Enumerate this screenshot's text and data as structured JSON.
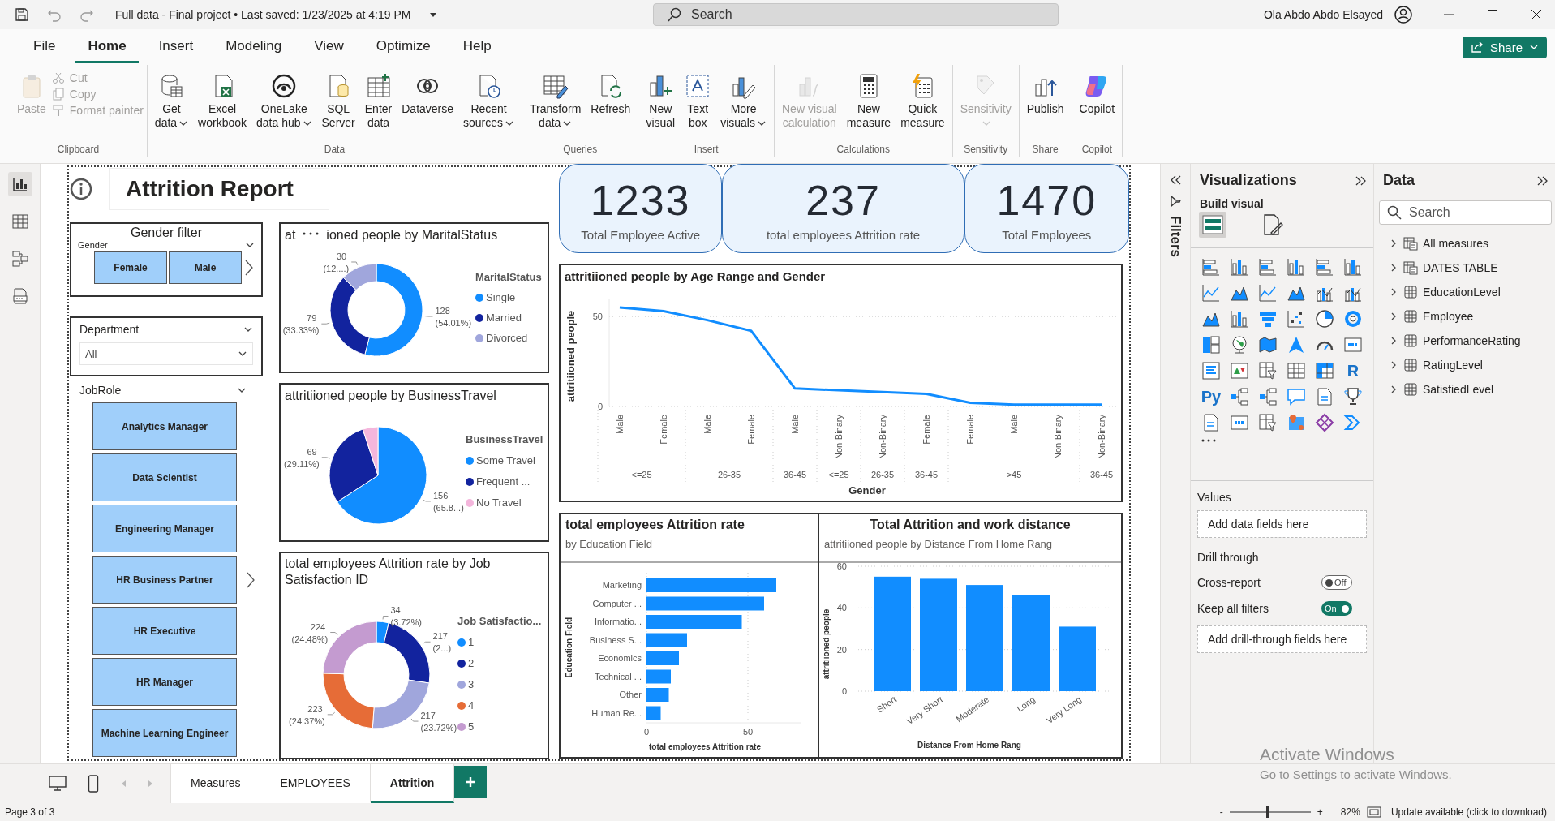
{
  "title_bar": {
    "document_title": "Full data - Final project • Last saved: 1/23/2025 at 4:19 PM",
    "search_placeholder": "Search",
    "user_name": "Ola Abdo Abdo Elsayed"
  },
  "menu": {
    "tabs": [
      {
        "label": "File",
        "selected": false
      },
      {
        "label": "Home",
        "selected": true
      },
      {
        "label": "Insert",
        "selected": false
      },
      {
        "label": "Modeling",
        "selected": false
      },
      {
        "label": "View",
        "selected": false
      },
      {
        "label": "Optimize",
        "selected": false
      },
      {
        "label": "Help",
        "selected": false
      }
    ],
    "share_button": "Share"
  },
  "ribbon": {
    "groups": [
      {
        "name": "Clipboard",
        "items": [
          {
            "lines": [
              "Paste"
            ],
            "kind": "large",
            "disabled": true,
            "caret": false
          },
          {
            "lines": [
              "Cut"
            ],
            "kind": "small",
            "disabled": true,
            "caret": false
          },
          {
            "lines": [
              "Copy"
            ],
            "kind": "small",
            "disabled": true,
            "caret": false
          },
          {
            "lines": [
              "Format painter"
            ],
            "kind": "small",
            "disabled": true,
            "caret": false
          }
        ]
      },
      {
        "name": "Data",
        "items": [
          {
            "lines": [
              "Get",
              "data"
            ],
            "kind": "large",
            "disabled": false,
            "caret": true
          },
          {
            "lines": [
              "Excel",
              "workbook"
            ],
            "kind": "large",
            "disabled": false,
            "caret": false
          },
          {
            "lines": [
              "OneLake",
              "data hub"
            ],
            "kind": "large",
            "disabled": false,
            "caret": true
          },
          {
            "lines": [
              "SQL",
              "Server"
            ],
            "kind": "large",
            "disabled": false,
            "caret": false
          },
          {
            "lines": [
              "Enter",
              "data"
            ],
            "kind": "large",
            "disabled": false,
            "caret": false
          },
          {
            "lines": [
              "Dataverse"
            ],
            "kind": "large",
            "disabled": false,
            "caret": false
          },
          {
            "lines": [
              "Recent",
              "sources"
            ],
            "kind": "large",
            "disabled": false,
            "caret": true
          }
        ]
      },
      {
        "name": "Queries",
        "items": [
          {
            "lines": [
              "Transform",
              "data"
            ],
            "kind": "large",
            "disabled": false,
            "caret": true
          },
          {
            "lines": [
              "Refresh"
            ],
            "kind": "large",
            "disabled": false,
            "caret": false
          }
        ]
      },
      {
        "name": "Insert",
        "items": [
          {
            "lines": [
              "New",
              "visual"
            ],
            "kind": "large",
            "disabled": false,
            "caret": false
          },
          {
            "lines": [
              "Text",
              "box"
            ],
            "kind": "large",
            "disabled": false,
            "caret": false
          },
          {
            "lines": [
              "More",
              "visuals"
            ],
            "kind": "large",
            "disabled": false,
            "caret": true
          }
        ]
      },
      {
        "name": "Calculations",
        "items": [
          {
            "lines": [
              "New visual",
              "calculation"
            ],
            "kind": "large",
            "disabled": true,
            "caret": false
          },
          {
            "lines": [
              "New",
              "measure"
            ],
            "kind": "large",
            "disabled": false,
            "caret": false
          },
          {
            "lines": [
              "Quick",
              "measure"
            ],
            "kind": "large",
            "disabled": false,
            "caret": false
          }
        ]
      },
      {
        "name": "Sensitivity",
        "items": [
          {
            "lines": [
              "Sensitivity"
            ],
            "kind": "large",
            "disabled": true,
            "caret": true
          }
        ]
      },
      {
        "name": "Share",
        "items": [
          {
            "lines": [
              "Publish"
            ],
            "kind": "large",
            "disabled": false,
            "caret": false
          }
        ]
      },
      {
        "name": "Copilot",
        "items": [
          {
            "lines": [
              "Copilot"
            ],
            "kind": "large",
            "disabled": false,
            "caret": false
          }
        ]
      }
    ]
  },
  "nav": [
    {
      "selected": true
    },
    {
      "selected": false
    },
    {
      "selected": false
    },
    {
      "selected": false
    }
  ],
  "report": {
    "title": "Attrition Report",
    "kpis": [
      {
        "value": "1233",
        "label": "Total Employee Active"
      },
      {
        "value": "237",
        "label": "total employees Attrition rate"
      },
      {
        "value": "1470",
        "label": "Total Employees"
      }
    ],
    "gender_slicer": {
      "title": "Gender filter",
      "header": "Gender",
      "tiles": [
        "Female",
        "Male"
      ]
    },
    "department_slicer": {
      "header": "Department",
      "value": "All"
    },
    "jobrole_slicer": {
      "header": "JobRole",
      "tiles": [
        "Analytics Manager",
        "Data Scientist",
        "Engineering Manager",
        "HR Business Partner",
        "HR Executive",
        "HR Manager",
        "Machine Learning Engineer"
      ]
    },
    "marital": {
      "title_parts": [
        "at",
        "ioned people by MaritalStatus"
      ],
      "chart_data": {
        "type": "donut",
        "categories": [
          "Single",
          "Married",
          "Divorced"
        ],
        "values": [
          128,
          79,
          30
        ],
        "colors": [
          "#118dff",
          "#12239e",
          "#a0a6dc"
        ],
        "value_labels": [
          "128 (54.01%)",
          "79 (33.33%)",
          "30 (12....)"
        ],
        "legend": {
          "title": "MaritalStatus"
        }
      }
    },
    "travel": {
      "title": "attritiioned people by BusinessTravel",
      "chart_data": {
        "type": "pie",
        "categories": [
          "Some Travel",
          "Frequent ...",
          "No Travel"
        ],
        "values": [
          156,
          69,
          12
        ],
        "colors": [
          "#118dff",
          "#12239e",
          "#f4b6dc"
        ],
        "value_labels": [
          "156 (65.8...)",
          "69 (29.11%)",
          null
        ],
        "legend": {
          "title": "BusinessTravel"
        }
      }
    },
    "jobsat": {
      "title": "total employees Attrition rate by Job Satisfaction ID",
      "chart_data": {
        "type": "donut",
        "categories": [
          "1",
          "2",
          "3",
          "4",
          "5"
        ],
        "values": [
          34,
          217,
          217,
          223,
          224
        ],
        "colors": [
          "#118dff",
          "#12239e",
          "#a0a6dc",
          "#e66c37",
          "#c49bd0"
        ],
        "value_labels": [
          "34 (3.72%)",
          "217 (2...)",
          "217 (23.72%)",
          "223 (24.37%)",
          "224 (24.48%)"
        ],
        "legend": {
          "title": "Job Satisfactio..."
        }
      }
    },
    "age_line": {
      "title": "attritiioned people by Age Range and Gender",
      "chart_data": {
        "type": "line",
        "categories": [
          "Male",
          "Female",
          "Male",
          "Female",
          "Male",
          "Non-Binary",
          "Non-Binary",
          "Female",
          "Female",
          "Male",
          "Non-Binary",
          "Non-Binary"
        ],
        "annotations": [
          "<=25",
          "26-35",
          "36-45",
          "<=25",
          "26-35",
          "36-45",
          ">45",
          "36-45"
        ],
        "series": [
          {
            "color": "#118dff",
            "values": [
              55,
              53,
              48,
              42,
              10,
              9,
              8,
              7,
              2,
              1,
              1,
              1
            ]
          }
        ],
        "xlabel": "Gender",
        "ylabel": "attritiioned people",
        "ylim": [
          0,
          60
        ],
        "yticks": [
          0,
          50
        ]
      }
    },
    "education": {
      "title": "total employees Attrition rate",
      "subtitle": "by Education Field",
      "chart_data": {
        "type": "bar",
        "orientation": "horizontal",
        "categories": [
          "Marketing",
          "Computer ...",
          "Informatio...",
          "Business S...",
          "Economics",
          "Technical ...",
          "Other",
          "Human Re..."
        ],
        "series": [
          {
            "color": "#118dff",
            "values": [
              64,
              58,
              47,
              20,
              16,
              12,
              11,
              7
            ]
          }
        ],
        "xlabel": "total employees Attrition rate",
        "ylabel": "Education Field",
        "xlim": [
          0,
          76
        ],
        "xticks": [
          0,
          50
        ]
      }
    },
    "distance": {
      "title": "Total Attrition and work distance",
      "subtitle": "attritiioned people by Distance From Home Rang",
      "chart_data": {
        "type": "bar",
        "orientation": "vertical",
        "categories": [
          "Short",
          "Very Short",
          "Moderate",
          "Long",
          "Very Long"
        ],
        "series": [
          {
            "color": "#118dff",
            "values": [
              55,
              54,
              51,
              46,
              31
            ]
          }
        ],
        "xlabel": "Distance From Home Rang",
        "ylabel": "attritiioned people",
        "ylim": [
          0,
          60
        ],
        "yticks": [
          0,
          20,
          40,
          60
        ]
      }
    }
  },
  "filters_pane": {
    "label": "Filters"
  },
  "visualizations": {
    "title": "Visualizations",
    "build_label": "Build visual",
    "build_tabs": [
      {
        "selected": true
      },
      {
        "selected": false
      }
    ],
    "gallery_glyphs": [
      "R",
      "Py"
    ],
    "values_label": "Values",
    "values_well": "Add data fields here",
    "drill_label": "Drill through",
    "toggles": [
      {
        "label": "Cross-report",
        "on": false,
        "state_label": "Off"
      },
      {
        "label": "Keep all filters",
        "on": true,
        "state_label": "On"
      }
    ],
    "drill_well": "Add drill-through fields here"
  },
  "data_pane": {
    "title": "Data",
    "search_placeholder": "Search",
    "tables": [
      {
        "label": "All measures",
        "kind": "measures",
        "expanded": false
      },
      {
        "label": "DATES TABLE",
        "kind": "measures",
        "expanded": false
      },
      {
        "label": "EducationLevel",
        "kind": "table",
        "expanded": false
      },
      {
        "label": "Employee",
        "kind": "table",
        "expanded": false
      },
      {
        "label": "PerformanceRating",
        "kind": "table",
        "expanded": false
      },
      {
        "label": "RatingLevel",
        "kind": "table",
        "expanded": false
      },
      {
        "label": "SatisfiedLevel",
        "kind": "table",
        "expanded": false
      }
    ]
  },
  "pages": [
    {
      "label": "Measures",
      "selected": false
    },
    {
      "label": "EMPLOYEES",
      "selected": false
    },
    {
      "label": "Attrition",
      "selected": true
    }
  ],
  "status_bar": {
    "page": "Page 3 of 3",
    "zoom_out": "-",
    "zoom_in": "+",
    "zoom": {
      "level": 0.45
    },
    "zoom_value": "82%",
    "update": "Update available (click to download)"
  },
  "os_overlay": {
    "title": "Activate Windows",
    "message": "Go to Settings to activate Windows."
  }
}
